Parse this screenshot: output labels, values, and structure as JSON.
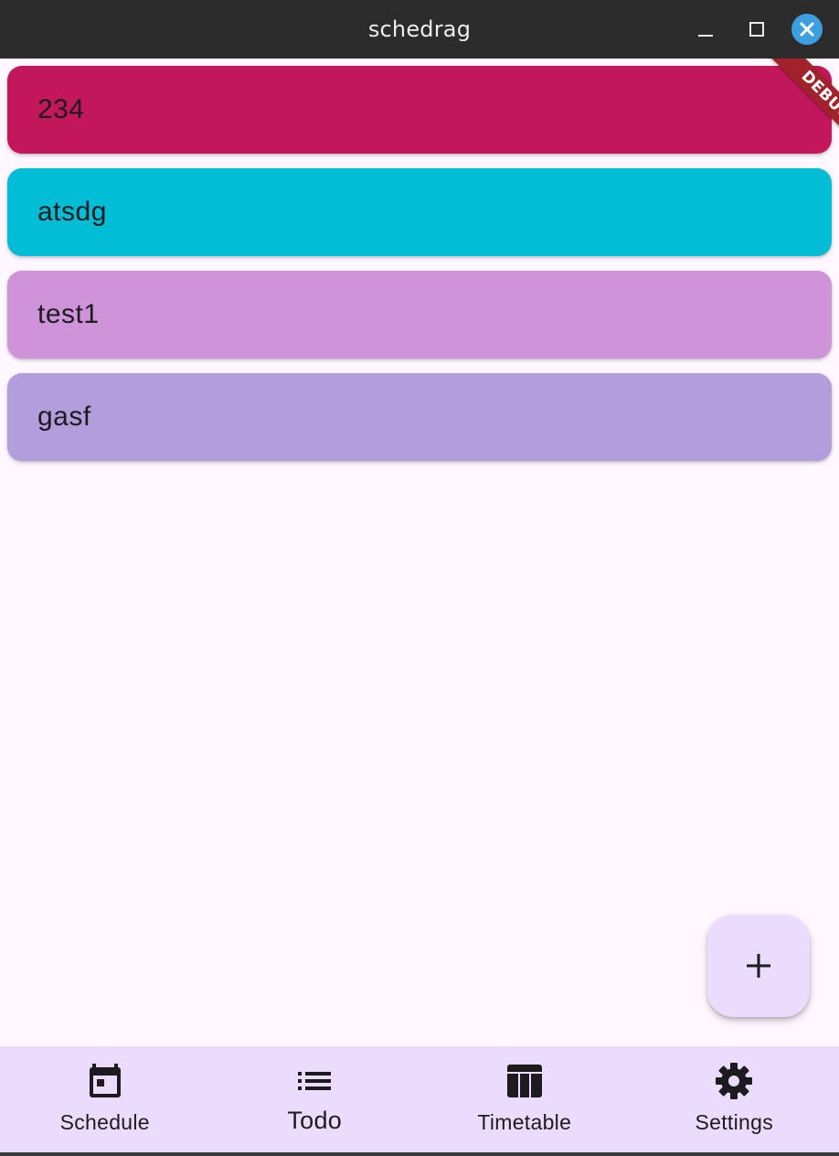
{
  "window": {
    "title": "schedrag"
  },
  "debug_banner": {
    "label": "DEBUG"
  },
  "todos": [
    {
      "label": "234",
      "color": "#c2185b"
    },
    {
      "label": "atsdg",
      "color": "#00bcd4"
    },
    {
      "label": "test1",
      "color": "#ce93d8"
    },
    {
      "label": "gasf",
      "color": "#b39ddb"
    }
  ],
  "fab": {
    "icon": "plus-icon"
  },
  "bottom_nav": {
    "selected": "Todo",
    "items": [
      {
        "label": "Schedule",
        "icon": "calendar-icon"
      },
      {
        "label": "Todo",
        "icon": "list-icon"
      },
      {
        "label": "Timetable",
        "icon": "table-icon"
      },
      {
        "label": "Settings",
        "icon": "gear-icon"
      }
    ]
  },
  "colors": {
    "background": "#fef7fe",
    "nav_background": "#ebdcfd",
    "fab_background": "#ebdcfd",
    "titlebar": "#2c2c2c",
    "close_button": "#3b9fe0"
  }
}
